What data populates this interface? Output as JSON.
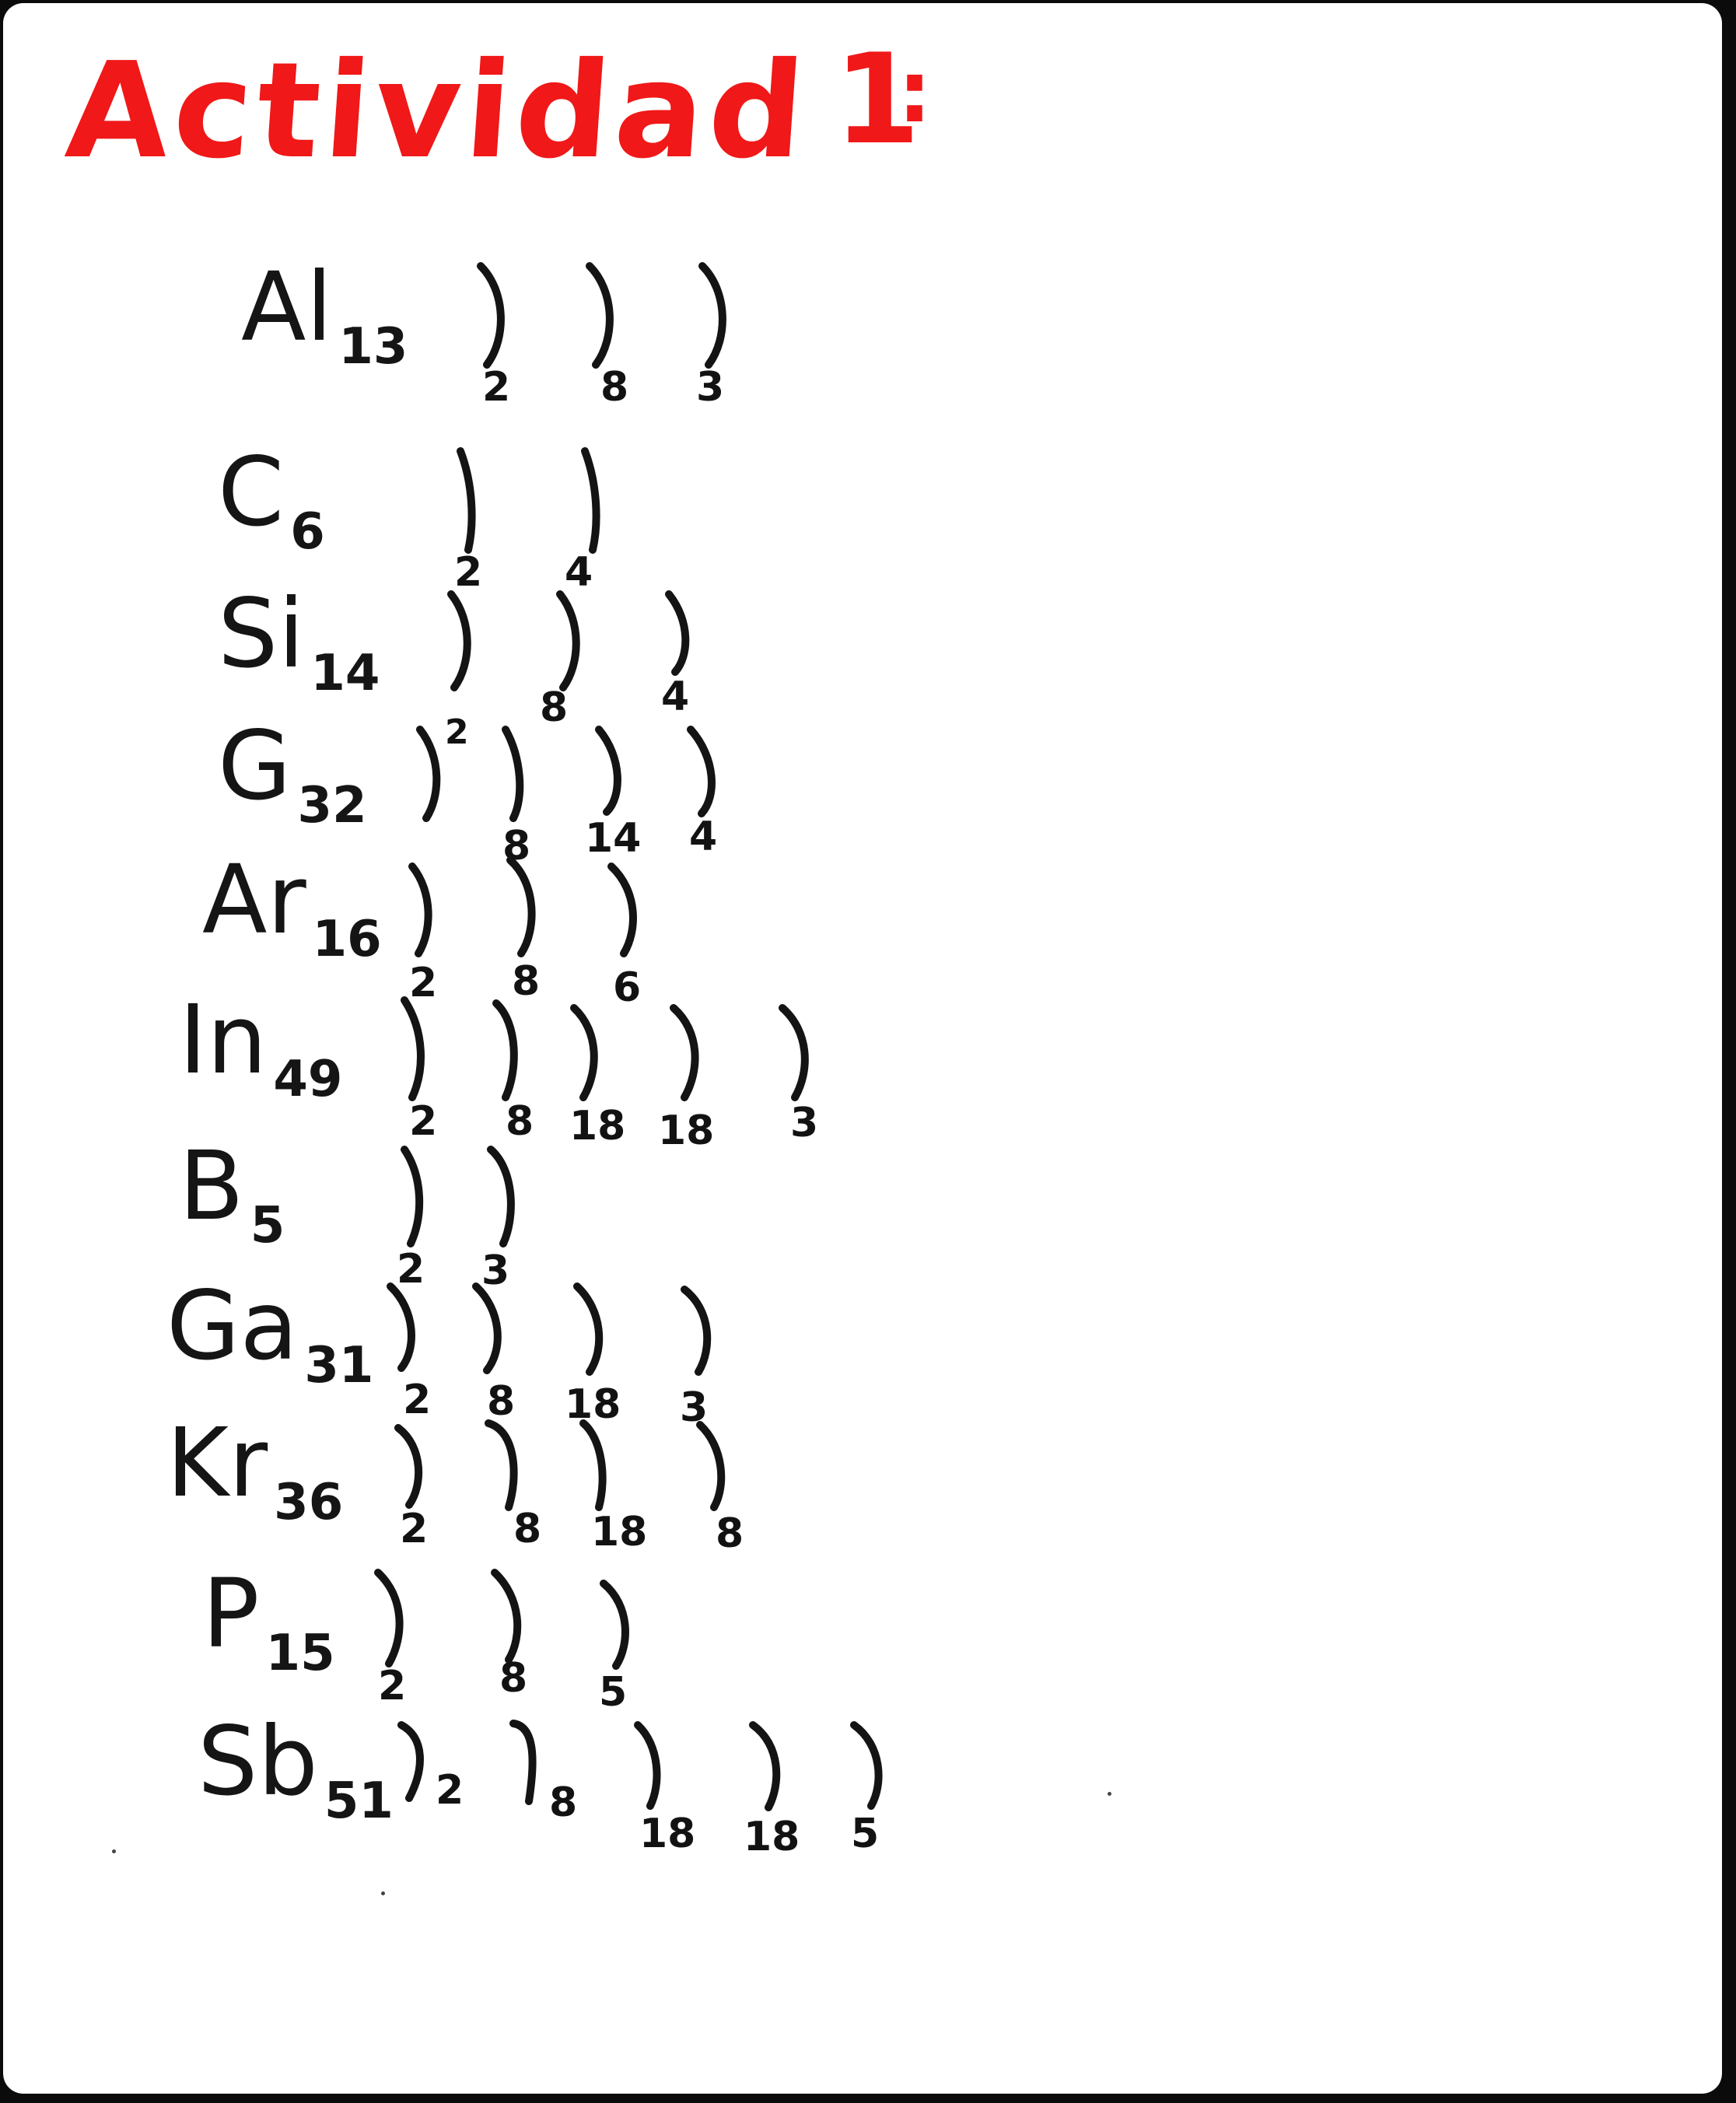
{
  "title": "Actividad",
  "activity_number": "1",
  "title_colon": ":",
  "entries": [
    {
      "symbol": "Al",
      "z": "13",
      "shells": [
        "2",
        "8",
        "3"
      ]
    },
    {
      "symbol": "C",
      "z": "6",
      "shells": [
        "2",
        "4"
      ]
    },
    {
      "symbol": "Si",
      "z": "14",
      "shells": [
        "2",
        "8",
        "4"
      ]
    },
    {
      "symbol": "G",
      "z": "32",
      "shells": [
        "2",
        "8",
        "14",
        "4"
      ]
    },
    {
      "symbol": "Ar",
      "z": "16",
      "shells": [
        "2",
        "8",
        "6"
      ]
    },
    {
      "symbol": "In",
      "z": "49",
      "shells": [
        "2",
        "8",
        "18",
        "18",
        "3"
      ]
    },
    {
      "symbol": "B",
      "z": "5",
      "shells": [
        "2",
        "3"
      ]
    },
    {
      "symbol": "Ga",
      "z": "31",
      "shells": [
        "2",
        "8",
        "18",
        "3"
      ]
    },
    {
      "symbol": "Kr",
      "z": "36",
      "shells": [
        "2",
        "8",
        "18",
        "8"
      ]
    },
    {
      "symbol": "P",
      "z": "15",
      "shells": [
        "2",
        "8",
        "5"
      ]
    },
    {
      "symbol": "Sb",
      "z": "51",
      "shells": [
        "2",
        "8",
        "18",
        "18",
        "5"
      ]
    }
  ],
  "colors": {
    "title": "#f01818",
    "ink": "#151515",
    "board": "#ffffff",
    "frame": "#0b0b0b"
  }
}
